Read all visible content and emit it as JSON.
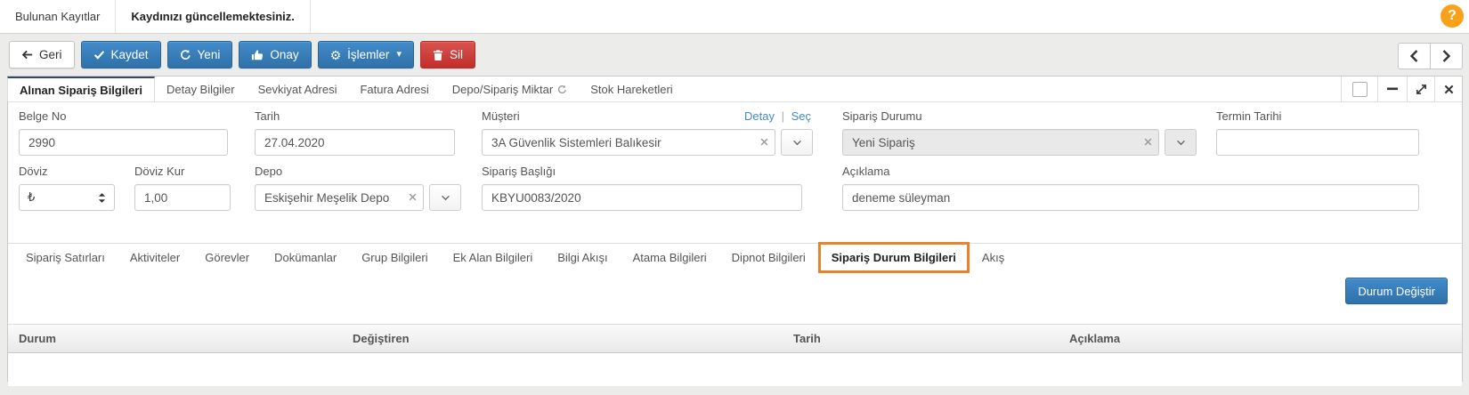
{
  "page": {
    "help_label": "?"
  },
  "top_tabs": {
    "items": [
      {
        "label": "Bulunan Kayıtlar"
      },
      {
        "label": "Kaydınızı güncellemektesiniz."
      }
    ]
  },
  "toolbar": {
    "back_label": "Geri",
    "save_label": "Kaydet",
    "new_label": "Yeni",
    "approve_label": "Onay",
    "operations_label": "İşlemler",
    "operations_caret": "▾",
    "delete_label": "Sil",
    "gear_glyph": "⚙"
  },
  "panel_tabs": {
    "items": [
      {
        "label": "Alınan Sipariş Bilgileri"
      },
      {
        "label": "Detay Bilgiler"
      },
      {
        "label": "Sevkiyat Adresi"
      },
      {
        "label": "Fatura Adresi"
      },
      {
        "label": "Depo/Sipariş Miktar"
      },
      {
        "label": "Stok Hareketleri"
      }
    ]
  },
  "form": {
    "belge_no": {
      "label": "Belge No",
      "value": "2990"
    },
    "tarih": {
      "label": "Tarih",
      "value": "27.04.2020"
    },
    "musteri": {
      "label": "Müşteri",
      "value": "3A Güvenlik Sistemleri Balıkesir",
      "detail_link": "Detay",
      "links_separator": "|",
      "select_link": "Seç"
    },
    "siparis_durumu": {
      "label": "Sipariş Durumu",
      "value": "Yeni Sipariş"
    },
    "termin_tarihi": {
      "label": "Termin Tarihi",
      "value": ""
    },
    "doviz": {
      "label": "Döviz",
      "value": "₺"
    },
    "doviz_kur": {
      "label": "Döviz Kur",
      "value": "1,00"
    },
    "depo": {
      "label": "Depo",
      "value": "Eskişehir Meşelik Depo"
    },
    "siparis_basligi": {
      "label": "Sipariş Başlığı",
      "value": "KBYU0083/2020"
    },
    "aciklama": {
      "label": "Açıklama",
      "value": "deneme süleyman"
    }
  },
  "sub_tabs": {
    "items": [
      {
        "label": "Sipariş Satırları"
      },
      {
        "label": "Aktiviteler"
      },
      {
        "label": "Görevler"
      },
      {
        "label": "Dokümanlar"
      },
      {
        "label": "Grup Bilgileri"
      },
      {
        "label": "Ek Alan Bilgileri"
      },
      {
        "label": "Bilgi Akışı"
      },
      {
        "label": "Atama Bilgileri"
      },
      {
        "label": "Dipnot Bilgileri"
      },
      {
        "label": "Sipariş Durum Bilgileri"
      },
      {
        "label": "Akış"
      }
    ],
    "highlighted": "Sipariş Durum Bilgileri"
  },
  "status_section": {
    "change_status_label": "Durum Değiştir",
    "table": {
      "headers": [
        "Durum",
        "Değiştiren",
        "Tarih",
        "Açıklama"
      ],
      "rows": []
    }
  },
  "colors": {
    "primary_blue": "#3276b1",
    "danger_red": "#c12e2a",
    "highlight_orange": "#e8832a",
    "help_orange": "#f9a11b",
    "link_blue": "#428bca",
    "active_tab_top": "#34495e"
  }
}
